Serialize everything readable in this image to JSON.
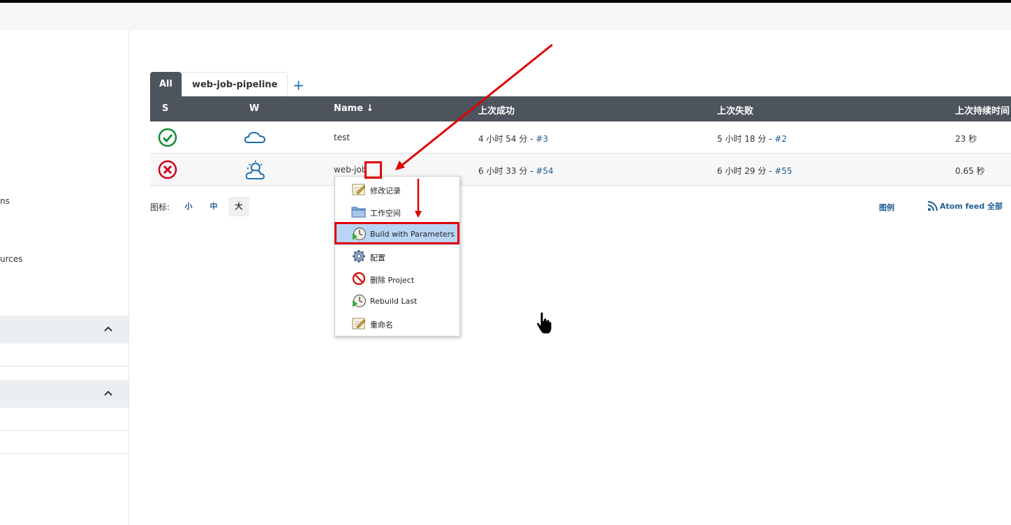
{
  "sidebar": {
    "fragment_1": "ns",
    "fragment_2": "urces"
  },
  "view_tabs": {
    "tabs": [
      {
        "label": "All",
        "active": true
      },
      {
        "label": "web-job-pipeline",
        "active": false
      }
    ],
    "add_label": "+"
  },
  "jobs_table": {
    "headers": {
      "s": "S",
      "w": "W",
      "name": "Name ↓",
      "last_success": "上次成功",
      "last_failure": "上次失败",
      "last_duration": "上次持续时间"
    },
    "rows": [
      {
        "status": "success",
        "weather": "cloudy",
        "name": "test",
        "last_success_time": "4 小时 54 分 - ",
        "last_success_build": "#3",
        "last_failure_time": "5 小时 18 分 - ",
        "last_failure_build": "#2",
        "duration": "23 秒"
      },
      {
        "status": "failed",
        "weather": "partly-sunny",
        "name": "web-job",
        "last_success_time": "6 小时 33 分 - ",
        "last_success_build": "#54",
        "last_failure_time": "6 小时 29 分 - ",
        "last_failure_build": "#55",
        "duration": "0.65 秒"
      }
    ]
  },
  "icon_size": {
    "label": "图标:",
    "small": "小",
    "medium": "中",
    "large": "大",
    "selected": "large"
  },
  "footer_links": {
    "legend": "图例",
    "atom_feed": "Atom feed 全部"
  },
  "context_menu": {
    "items": [
      {
        "label": "修改记录",
        "icon": "notepad-icon"
      },
      {
        "label": "工作空间",
        "icon": "folder-icon"
      },
      {
        "label": "Build with Parameters",
        "icon": "clock-play-icon",
        "selected": true
      },
      {
        "label": "配置",
        "icon": "gear-icon"
      },
      {
        "label": "删除 Project",
        "icon": "no-entry-icon"
      },
      {
        "label": "Rebuild Last",
        "icon": "clock-play-icon"
      },
      {
        "label": "重命名",
        "icon": "notepad-icon"
      }
    ]
  },
  "colors": {
    "header_dark": "#4d545d",
    "link_blue": "#1f5e94",
    "success_green": "#138a36",
    "failure_red": "#d0021b",
    "annotation_red": "#e00000",
    "menu_selected": "#b9d5f6"
  }
}
